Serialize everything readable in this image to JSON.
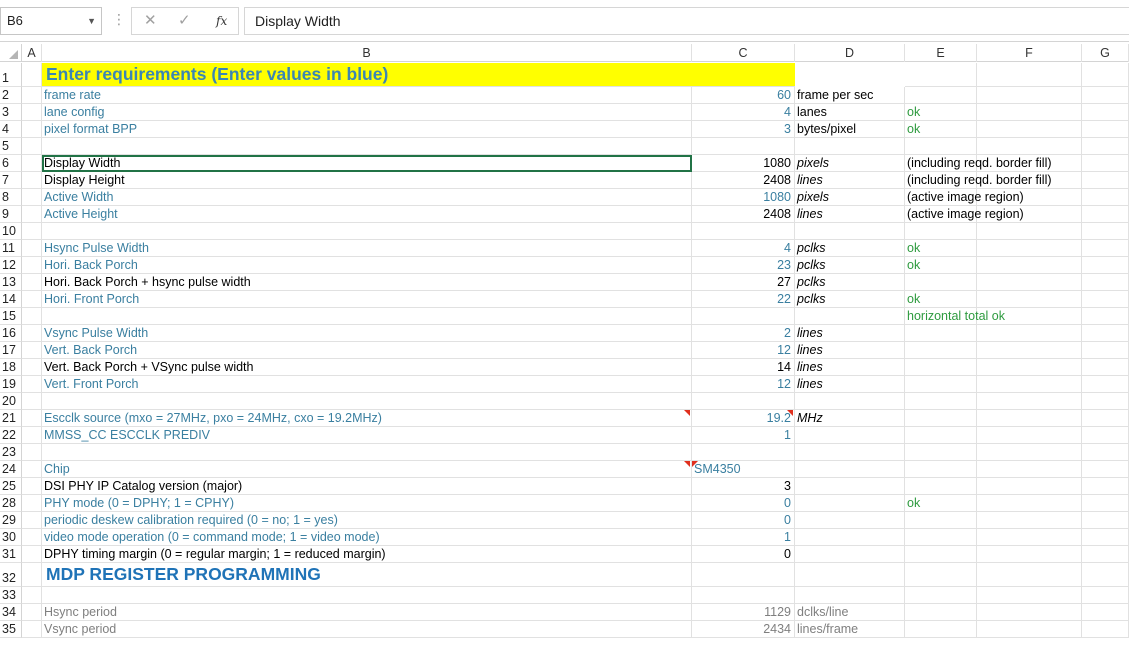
{
  "formula_bar": {
    "name_box": "B6",
    "dropdown_glyph": "▼",
    "separator_glyph": "⋮",
    "cancel_glyph": "✕",
    "enter_glyph": "✓",
    "fx_label": "fx",
    "formula": "Display Width"
  },
  "columns": [
    "A",
    "B",
    "C",
    "D",
    "E",
    "F",
    "G"
  ],
  "rows": [
    {
      "row": "1",
      "b": "Enter requirements (Enter values in blue)"
    },
    {
      "row": "2",
      "b": "frame rate",
      "c": "60",
      "d": "frame per sec"
    },
    {
      "row": "3",
      "b": "lane config",
      "c": "4",
      "d": "lanes",
      "e": "ok"
    },
    {
      "row": "4",
      "b": "pixel format BPP",
      "c": "3",
      "d": "bytes/pixel",
      "e": "ok"
    },
    {
      "row": "5"
    },
    {
      "row": "6",
      "b": "Display Width",
      "c": "1080",
      "d": "pixels",
      "e": "(including reqd. border fill)"
    },
    {
      "row": "7",
      "b": "Display Height",
      "c": "2408",
      "d": "lines",
      "e": "(including reqd. border fill)"
    },
    {
      "row": "8",
      "b": "Active Width",
      "c": "1080",
      "d": "pixels",
      "e": "(active image region)"
    },
    {
      "row": "9",
      "b": "Active Height",
      "c": "2408",
      "d": "lines",
      "e": "(active image region)"
    },
    {
      "row": "10"
    },
    {
      "row": "11",
      "b": "Hsync Pulse Width",
      "c": "4",
      "d": "pclks",
      "e": "ok"
    },
    {
      "row": "12",
      "b": "Hori. Back Porch",
      "c": "23",
      "d": "pclks",
      "e": "ok"
    },
    {
      "row": "13",
      "b": "Hori. Back Porch + hsync pulse width",
      "c": "27",
      "d": "pclks"
    },
    {
      "row": "14",
      "b": "Hori. Front Porch",
      "c": "22",
      "d": "pclks",
      "e": "ok"
    },
    {
      "row": "15",
      "e": "horizontal total ok"
    },
    {
      "row": "16",
      "b": "Vsync Pulse Width",
      "c": "2",
      "d": "lines"
    },
    {
      "row": "17",
      "b": "Vert. Back Porch",
      "c": "12",
      "d": "lines"
    },
    {
      "row": "18",
      "b": "Vert. Back Porch + VSync pulse width",
      "c": "14",
      "d": "lines"
    },
    {
      "row": "19",
      "b": "Vert. Front Porch",
      "c": "12",
      "d": "lines"
    },
    {
      "row": "20"
    },
    {
      "row": "21",
      "b": "Escclk source (mxo = 27MHz, pxo = 24MHz, cxo = 19.2MHz)",
      "c": "19.2",
      "d": "MHz"
    },
    {
      "row": "22",
      "b": "MMSS_CC ESCCLK PREDIV",
      "c": "1"
    },
    {
      "row": "23"
    },
    {
      "row": "24",
      "b": "Chip",
      "c": "SM4350"
    },
    {
      "row": "25",
      "b": "DSI PHY IP Catalog version (major)",
      "c": "3"
    },
    {
      "row": "28",
      "b": "PHY mode (0 = DPHY; 1 = CPHY)",
      "c": "0",
      "e": "ok"
    },
    {
      "row": "29",
      "b": "periodic deskew calibration required (0 = no; 1 = yes)",
      "c": "0"
    },
    {
      "row": "30",
      "b": "video mode operation (0 = command mode; 1 = video mode)",
      "c": "1"
    },
    {
      "row": "31",
      "b": "DPHY timing margin (0 = regular margin; 1 = reduced margin)",
      "c": "0"
    },
    {
      "row": "32",
      "b": "MDP REGISTER PROGRAMMING"
    },
    {
      "row": "33"
    },
    {
      "row": "34",
      "b": "Hsync period",
      "c": "1129",
      "d": "dclks/line"
    },
    {
      "row": "35",
      "b": "Vsync period",
      "c": "2434",
      "d": "lines/frame"
    }
  ],
  "colors": {
    "input_blue": "#3a7fa0",
    "ok_green": "#2e9b3f",
    "header_yellow": "#ffff00",
    "section_blue": "#1f73b7",
    "selection_green": "#217346"
  }
}
